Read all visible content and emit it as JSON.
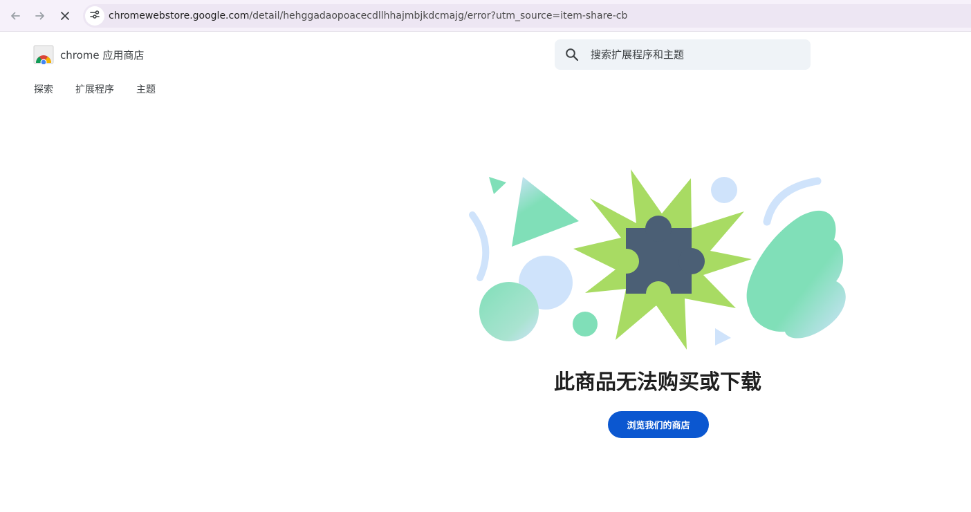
{
  "browser": {
    "url_host": "chromewebstore.google.com",
    "url_path": "/detail/hehggadaopoacecdllhhajmbjkdcmajg/error?utm_source=item-share-cb",
    "icons": [
      "back-arrow-icon",
      "forward-arrow-icon",
      "close-icon",
      "site-settings-icon"
    ]
  },
  "header": {
    "store_name": "chrome 应用商店",
    "search_placeholder": "搜索扩展程序和主题"
  },
  "nav": {
    "items": [
      {
        "label": "探索"
      },
      {
        "label": "扩展程序"
      },
      {
        "label": "主题"
      }
    ]
  },
  "main": {
    "title": "此商品无法购买或下载",
    "browse_button": "浏览我们的商店"
  },
  "colors": {
    "accent": "#0b57d0",
    "starburst": "#a8db63",
    "puzzle": "#4b5f75",
    "mint": "#80dfb8",
    "light_blue": "#cfe3fb"
  }
}
